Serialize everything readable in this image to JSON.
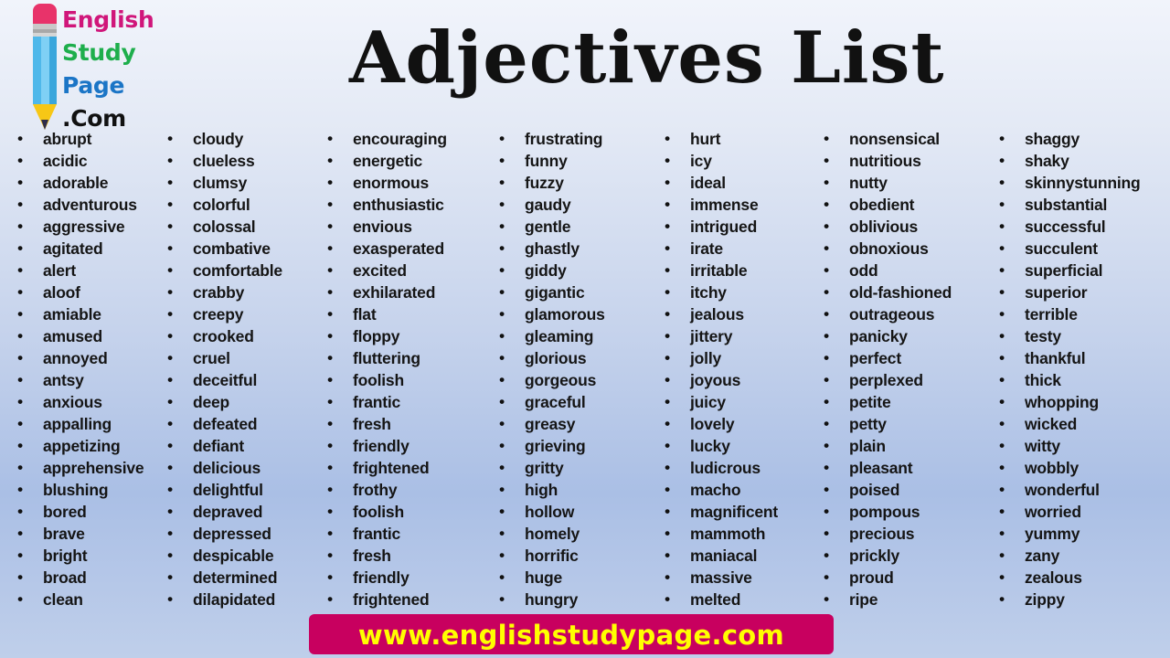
{
  "logo": {
    "line1": "English",
    "line2": "Study",
    "line3": "Page",
    "line4": ".Com",
    "icon": "pencil-icon",
    "colors": {
      "english": "#d0167a",
      "study": "#1eae4c",
      "page": "#1b75c6",
      "com": "#111111"
    }
  },
  "title": "Adjectives List",
  "bullet_glyph": "•",
  "columns": [
    [
      "abrupt",
      "acidic",
      "adorable",
      "adventurous",
      "aggressive",
      "agitated",
      "alert",
      "aloof",
      "amiable",
      "amused",
      "annoyed",
      "antsy",
      "anxious",
      "appalling",
      "appetizing",
      "apprehensive",
      "blushing",
      "bored",
      "brave",
      "bright",
      "broad",
      "clean"
    ],
    [
      "cloudy",
      "clueless",
      "clumsy",
      "colorful",
      "colossal",
      "combative",
      "comfortable",
      "crabby",
      "creepy",
      "crooked",
      "cruel",
      "deceitful",
      "deep",
      "defeated",
      "defiant",
      "delicious",
      "delightful",
      "depraved",
      "depressed",
      "despicable",
      "determined",
      "dilapidated"
    ],
    [
      "encouraging",
      "energetic",
      "enormous",
      "enthusiastic",
      "envious",
      "exasperated",
      "excited",
      "exhilarated",
      "flat",
      "floppy",
      "fluttering",
      "foolish",
      "frantic",
      "fresh",
      "friendly",
      "frightened",
      "frothy",
      "foolish",
      "frantic",
      "fresh",
      "friendly",
      "frightened"
    ],
    [
      "frustrating",
      "funny",
      "fuzzy",
      "gaudy",
      "gentle",
      "ghastly",
      "giddy",
      "gigantic",
      "glamorous",
      "gleaming",
      "glorious",
      "gorgeous",
      "graceful",
      "greasy",
      "grieving",
      "gritty",
      "high",
      "hollow",
      "homely",
      "horrific",
      "huge",
      "hungry"
    ],
    [
      "hurt",
      "icy",
      "ideal",
      "immense",
      "intrigued",
      "irate",
      "irritable",
      "itchy",
      "jealous",
      "jittery",
      "jolly",
      "joyous",
      "juicy",
      "lovely",
      "lucky",
      "ludicrous",
      "macho",
      "magnificent",
      "mammoth",
      "maniacal",
      "massive",
      "melted"
    ],
    [
      "nonsensical",
      "nutritious",
      "nutty",
      "obedient",
      "oblivious",
      "obnoxious",
      "odd",
      "old-fashioned",
      "outrageous",
      "panicky",
      "perfect",
      "perplexed",
      "petite",
      "petty",
      "plain",
      "pleasant",
      "poised",
      "pompous",
      "precious",
      "prickly",
      "proud",
      "ripe"
    ],
    [
      "shaggy",
      "shaky",
      "skinnystunning",
      "substantial",
      "successful",
      "succulent",
      "superficial",
      "superior",
      "terrible",
      "testy",
      "thankful",
      "thick",
      "whopping",
      "wicked",
      "witty",
      "wobbly",
      "wonderful",
      "worried",
      "yummy",
      "zany",
      "zealous",
      "zippy"
    ]
  ],
  "footer": {
    "url": "www.englishstudypage.com",
    "background": "#c8005f",
    "text_color": "#ffff00"
  }
}
